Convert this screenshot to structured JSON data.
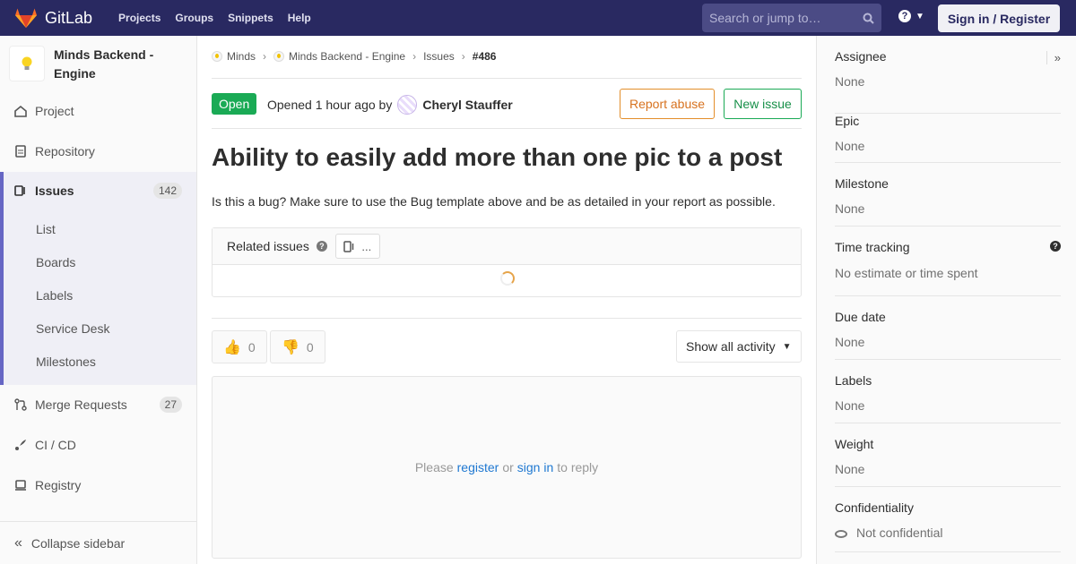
{
  "navbar": {
    "brand": "GitLab",
    "links": [
      "Projects",
      "Groups",
      "Snippets",
      "Help"
    ],
    "search_placeholder": "Search or jump to…",
    "signin_label": "Sign in / Register"
  },
  "sidebar": {
    "project_name": "Minds Backend - Engine",
    "items": [
      {
        "label": "Project"
      },
      {
        "label": "Repository"
      },
      {
        "label": "Issues",
        "count": "142"
      },
      {
        "label": "Merge Requests",
        "count": "27"
      },
      {
        "label": "CI / CD"
      },
      {
        "label": "Registry"
      }
    ],
    "sub_items": [
      "List",
      "Boards",
      "Labels",
      "Service Desk",
      "Milestones"
    ],
    "collapse_label": "Collapse sidebar"
  },
  "breadcrumb": [
    "Minds",
    "Minds Backend - Engine",
    "Issues",
    "#486"
  ],
  "issue": {
    "status": "Open",
    "opened_text": "Opened 1 hour ago by",
    "author": "Cheryl Stauffer",
    "report_abuse_label": "Report abuse",
    "new_issue_label": "New issue",
    "title": "Ability to easily add more than one pic to a post",
    "description": "Is this a bug? Make sure to use the Bug template above and be as detailed in your report as possible."
  },
  "related": {
    "heading": "Related issues",
    "count_text": "..."
  },
  "awards": {
    "thumbs_up": "0",
    "thumbs_down": "0"
  },
  "activity_filter": "Show all activity",
  "reply": {
    "prefix": "Please",
    "register": "register",
    "or": "or",
    "signin": "sign in",
    "suffix": "to reply"
  },
  "right_sidebar": {
    "assignee": {
      "label": "Assignee",
      "value": "None"
    },
    "epic": {
      "label": "Epic",
      "value": "None"
    },
    "milestone": {
      "label": "Milestone",
      "value": "None"
    },
    "time_tracking": {
      "label": "Time tracking",
      "value": "No estimate or time spent"
    },
    "due_date": {
      "label": "Due date",
      "value": "None"
    },
    "labels": {
      "label": "Labels",
      "value": "None"
    },
    "weight": {
      "label": "Weight",
      "value": "None"
    },
    "confidentiality": {
      "label": "Confidentiality",
      "value": "Not confidential"
    }
  },
  "colors": {
    "navbar": "#292961",
    "accent": "#6666c4",
    "open": "#1aaa55",
    "abuse": "#e38e2a",
    "link": "#1f78d1"
  }
}
